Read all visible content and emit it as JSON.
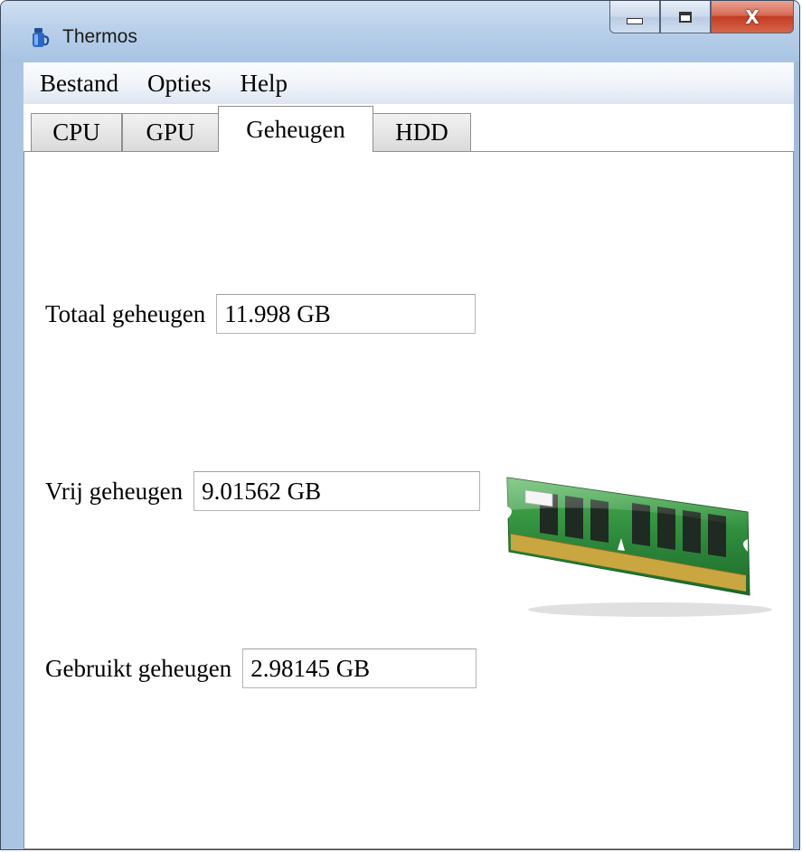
{
  "window": {
    "title": "Thermos",
    "icon": "thermos-app-icon"
  },
  "caption_buttons": {
    "minimize_icon": "minimize-icon",
    "maximize_icon": "maximize-icon",
    "close_glyph": "X"
  },
  "menu": {
    "items": [
      {
        "label": "Bestand"
      },
      {
        "label": "Opties"
      },
      {
        "label": "Help"
      }
    ]
  },
  "tabs": [
    {
      "label": "CPU",
      "active": false
    },
    {
      "label": "GPU",
      "active": false
    },
    {
      "label": "Geheugen",
      "active": true
    },
    {
      "label": "HDD",
      "active": false
    }
  ],
  "memory": {
    "total": {
      "label": "Totaal geheugen",
      "value": "11.998 GB"
    },
    "free": {
      "label": "Vrij geheugen",
      "value": "9.01562 GB"
    },
    "used": {
      "label": "Gebruikt geheugen",
      "value": "2.98145 GB"
    }
  },
  "image": {
    "icon": "ram-module-icon"
  },
  "colors": {
    "title_bar": "#b9d0ea",
    "close_button": "#c43c22",
    "ram_pcb": "#2e8b3c",
    "ram_contacts": "#c9a640"
  }
}
